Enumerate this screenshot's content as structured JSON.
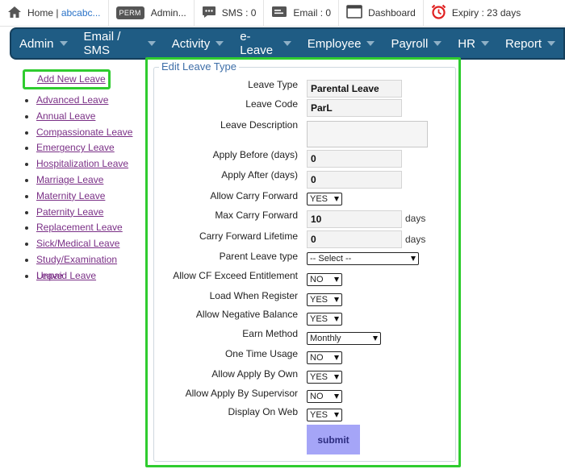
{
  "topbar": {
    "home_label": "Home | ",
    "home_link": "abcabc...",
    "perm_badge": "PERM",
    "admin_label": "Admin...",
    "sms_label": "SMS : 0",
    "email_label": "Email : 0",
    "dashboard_label": "Dashboard",
    "expiry_label": "Expiry : 23 days",
    "icons": [
      "home-icon",
      "user-icon",
      "sms-icon",
      "email-icon",
      "dashboard-icon",
      "alarm-clock-icon"
    ]
  },
  "nav": [
    "Admin",
    "Email / SMS",
    "Activity",
    "e-Leave",
    "Employee",
    "Payroll",
    "HR",
    "Report"
  ],
  "sidebar": {
    "items": [
      "Add New Leave",
      "Advanced Leave",
      "Annual Leave",
      "Compassionate Leave",
      "Emergency Leave",
      "Hospitalization Leave",
      "Marriage Leave",
      "Maternity Leave",
      "Paternity Leave",
      "Replacement Leave",
      "Sick/Medical Leave",
      "Study/Examination Leave",
      "Unpaid Leave"
    ]
  },
  "form": {
    "title": "Edit Leave Type",
    "leave_type": {
      "label": "Leave Type",
      "value": "Parental Leave"
    },
    "leave_code": {
      "label": "Leave Code",
      "value": "ParL"
    },
    "leave_description": {
      "label": "Leave Description",
      "value": ""
    },
    "apply_before": {
      "label": "Apply Before (days)",
      "value": "0"
    },
    "apply_after": {
      "label": "Apply After (days)",
      "value": "0"
    },
    "allow_carry_forward": {
      "label": "Allow Carry Forward",
      "value": "YES"
    },
    "max_carry_forward": {
      "label": "Max Carry Forward",
      "value": "10",
      "unit": "days"
    },
    "carry_forward_lifetime": {
      "label": "Carry Forward Lifetime",
      "value": "0",
      "unit": "days"
    },
    "parent_leave_type": {
      "label": "Parent Leave type",
      "value": "-- Select --"
    },
    "allow_cf_exceed": {
      "label": "Allow CF Exceed Entitlement",
      "value": "NO"
    },
    "load_when_register": {
      "label": "Load When Register",
      "value": "YES"
    },
    "allow_negative_balance": {
      "label": "Allow Negative Balance",
      "value": "YES"
    },
    "earn_method": {
      "label": "Earn Method",
      "value": "Monthly"
    },
    "one_time_usage": {
      "label": "One Time Usage",
      "value": "NO"
    },
    "allow_apply_by_own": {
      "label": "Allow Apply By Own",
      "value": "YES"
    },
    "allow_apply_by_supervisor": {
      "label": "Allow Apply By Supervisor",
      "value": "NO"
    },
    "display_on_web": {
      "label": "Display On Web",
      "value": "YES"
    },
    "submit_label": "submit"
  }
}
